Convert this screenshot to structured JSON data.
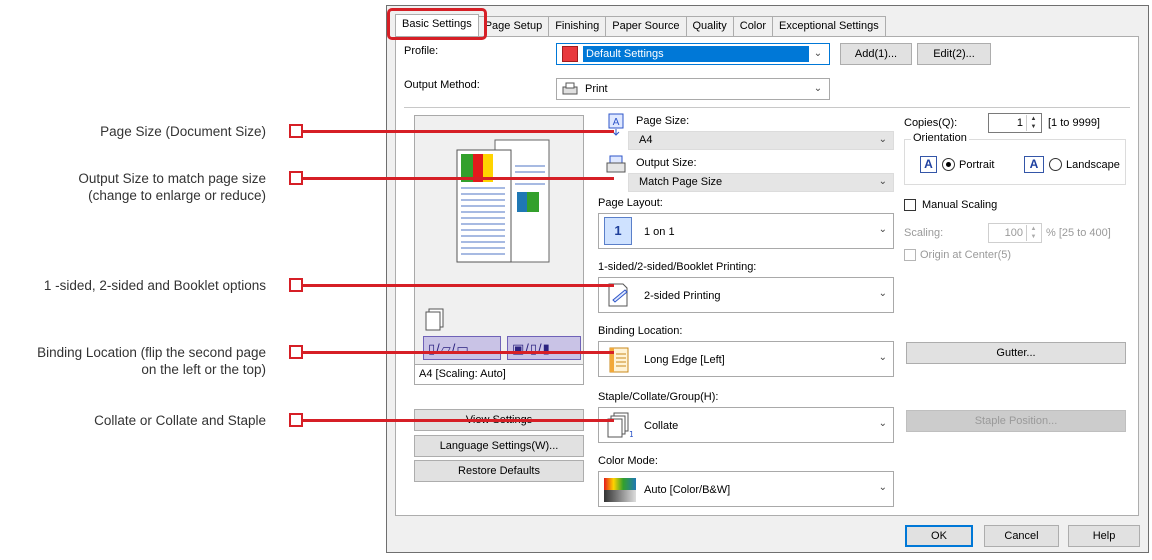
{
  "annotations": [
    {
      "text": "Page Size (Document Size)"
    },
    {
      "text": "Output Size to match page size\n(change to enlarge or reduce)"
    },
    {
      "text": "1 -sided, 2-sided and Booklet options"
    },
    {
      "text": "Binding Location (flip the second page\non the left or the top)"
    },
    {
      "text": "Collate or Collate and Staple"
    }
  ],
  "tabs": [
    {
      "label": "Basic Settings",
      "active": true
    },
    {
      "label": "Page Setup"
    },
    {
      "label": "Finishing"
    },
    {
      "label": "Paper Source"
    },
    {
      "label": "Quality"
    },
    {
      "label": "Color"
    },
    {
      "label": "Exceptional Settings"
    }
  ],
  "profile": {
    "label": "Profile:",
    "value": "Default Settings",
    "add_label": "Add(1)...",
    "edit_label": "Edit(2)..."
  },
  "output_method": {
    "label": "Output Method:",
    "value": "Print"
  },
  "preview": {
    "caption": "A4 [Scaling: Auto]"
  },
  "left_buttons": {
    "view_settings": "View Settings",
    "language_settings": "Language Settings(W)...",
    "restore_defaults": "Restore Defaults"
  },
  "page_size": {
    "label": "Page Size:",
    "value": "A4"
  },
  "output_size": {
    "label": "Output Size:",
    "value": "Match Page Size"
  },
  "page_layout": {
    "label": "Page Layout:",
    "value": "1 on 1",
    "icon_text": "1"
  },
  "sided": {
    "label": "1-sided/2-sided/Booklet Printing:",
    "value": "2-sided Printing"
  },
  "binding": {
    "label": "Binding Location:",
    "value": "Long Edge [Left]"
  },
  "staple": {
    "label": "Staple/Collate/Group(H):",
    "value": "Collate"
  },
  "color_mode": {
    "label": "Color Mode:",
    "value": "Auto [Color/B&W]"
  },
  "copies": {
    "label": "Copies(Q):",
    "value": "1",
    "range": "[1 to 9999]"
  },
  "orientation": {
    "group_label": "Orientation",
    "portrait": "Portrait",
    "landscape": "Landscape",
    "selected": "Portrait",
    "icon_letter": "A"
  },
  "manual_scaling": {
    "label": "Manual Scaling",
    "checked": false
  },
  "scaling": {
    "label": "Scaling:",
    "value": "100",
    "unit_range": "% [25 to 400]"
  },
  "origin": {
    "label": "Origin at Center(5)",
    "checked": false
  },
  "gutter_label": "Gutter...",
  "staple_position_label": "Staple Position...",
  "footer": {
    "ok": "OK",
    "cancel": "Cancel",
    "help": "Help"
  },
  "colors": {
    "accent": "#0078d7",
    "annotation": "#d61f26"
  }
}
